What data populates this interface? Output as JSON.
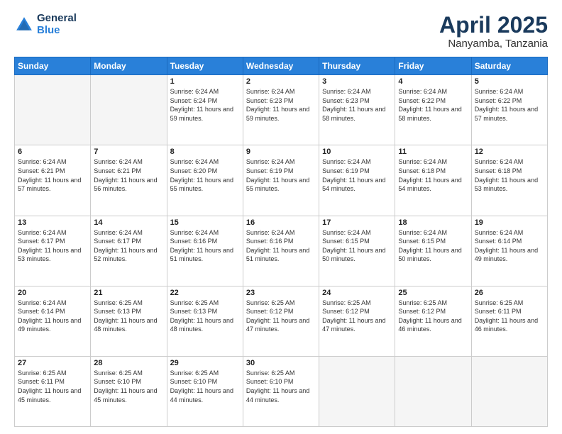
{
  "header": {
    "logo_general": "General",
    "logo_blue": "Blue",
    "month_title": "April 2025",
    "location": "Nanyamba, Tanzania"
  },
  "weekdays": [
    "Sunday",
    "Monday",
    "Tuesday",
    "Wednesday",
    "Thursday",
    "Friday",
    "Saturday"
  ],
  "weeks": [
    [
      {
        "day": "",
        "info": ""
      },
      {
        "day": "",
        "info": ""
      },
      {
        "day": "1",
        "info": "Sunrise: 6:24 AM\nSunset: 6:24 PM\nDaylight: 11 hours and 59 minutes."
      },
      {
        "day": "2",
        "info": "Sunrise: 6:24 AM\nSunset: 6:23 PM\nDaylight: 11 hours and 59 minutes."
      },
      {
        "day": "3",
        "info": "Sunrise: 6:24 AM\nSunset: 6:23 PM\nDaylight: 11 hours and 58 minutes."
      },
      {
        "day": "4",
        "info": "Sunrise: 6:24 AM\nSunset: 6:22 PM\nDaylight: 11 hours and 58 minutes."
      },
      {
        "day": "5",
        "info": "Sunrise: 6:24 AM\nSunset: 6:22 PM\nDaylight: 11 hours and 57 minutes."
      }
    ],
    [
      {
        "day": "6",
        "info": "Sunrise: 6:24 AM\nSunset: 6:21 PM\nDaylight: 11 hours and 57 minutes."
      },
      {
        "day": "7",
        "info": "Sunrise: 6:24 AM\nSunset: 6:21 PM\nDaylight: 11 hours and 56 minutes."
      },
      {
        "day": "8",
        "info": "Sunrise: 6:24 AM\nSunset: 6:20 PM\nDaylight: 11 hours and 55 minutes."
      },
      {
        "day": "9",
        "info": "Sunrise: 6:24 AM\nSunset: 6:19 PM\nDaylight: 11 hours and 55 minutes."
      },
      {
        "day": "10",
        "info": "Sunrise: 6:24 AM\nSunset: 6:19 PM\nDaylight: 11 hours and 54 minutes."
      },
      {
        "day": "11",
        "info": "Sunrise: 6:24 AM\nSunset: 6:18 PM\nDaylight: 11 hours and 54 minutes."
      },
      {
        "day": "12",
        "info": "Sunrise: 6:24 AM\nSunset: 6:18 PM\nDaylight: 11 hours and 53 minutes."
      }
    ],
    [
      {
        "day": "13",
        "info": "Sunrise: 6:24 AM\nSunset: 6:17 PM\nDaylight: 11 hours and 53 minutes."
      },
      {
        "day": "14",
        "info": "Sunrise: 6:24 AM\nSunset: 6:17 PM\nDaylight: 11 hours and 52 minutes."
      },
      {
        "day": "15",
        "info": "Sunrise: 6:24 AM\nSunset: 6:16 PM\nDaylight: 11 hours and 51 minutes."
      },
      {
        "day": "16",
        "info": "Sunrise: 6:24 AM\nSunset: 6:16 PM\nDaylight: 11 hours and 51 minutes."
      },
      {
        "day": "17",
        "info": "Sunrise: 6:24 AM\nSunset: 6:15 PM\nDaylight: 11 hours and 50 minutes."
      },
      {
        "day": "18",
        "info": "Sunrise: 6:24 AM\nSunset: 6:15 PM\nDaylight: 11 hours and 50 minutes."
      },
      {
        "day": "19",
        "info": "Sunrise: 6:24 AM\nSunset: 6:14 PM\nDaylight: 11 hours and 49 minutes."
      }
    ],
    [
      {
        "day": "20",
        "info": "Sunrise: 6:24 AM\nSunset: 6:14 PM\nDaylight: 11 hours and 49 minutes."
      },
      {
        "day": "21",
        "info": "Sunrise: 6:25 AM\nSunset: 6:13 PM\nDaylight: 11 hours and 48 minutes."
      },
      {
        "day": "22",
        "info": "Sunrise: 6:25 AM\nSunset: 6:13 PM\nDaylight: 11 hours and 48 minutes."
      },
      {
        "day": "23",
        "info": "Sunrise: 6:25 AM\nSunset: 6:12 PM\nDaylight: 11 hours and 47 minutes."
      },
      {
        "day": "24",
        "info": "Sunrise: 6:25 AM\nSunset: 6:12 PM\nDaylight: 11 hours and 47 minutes."
      },
      {
        "day": "25",
        "info": "Sunrise: 6:25 AM\nSunset: 6:12 PM\nDaylight: 11 hours and 46 minutes."
      },
      {
        "day": "26",
        "info": "Sunrise: 6:25 AM\nSunset: 6:11 PM\nDaylight: 11 hours and 46 minutes."
      }
    ],
    [
      {
        "day": "27",
        "info": "Sunrise: 6:25 AM\nSunset: 6:11 PM\nDaylight: 11 hours and 45 minutes."
      },
      {
        "day": "28",
        "info": "Sunrise: 6:25 AM\nSunset: 6:10 PM\nDaylight: 11 hours and 45 minutes."
      },
      {
        "day": "29",
        "info": "Sunrise: 6:25 AM\nSunset: 6:10 PM\nDaylight: 11 hours and 44 minutes."
      },
      {
        "day": "30",
        "info": "Sunrise: 6:25 AM\nSunset: 6:10 PM\nDaylight: 11 hours and 44 minutes."
      },
      {
        "day": "",
        "info": ""
      },
      {
        "day": "",
        "info": ""
      },
      {
        "day": "",
        "info": ""
      }
    ]
  ]
}
